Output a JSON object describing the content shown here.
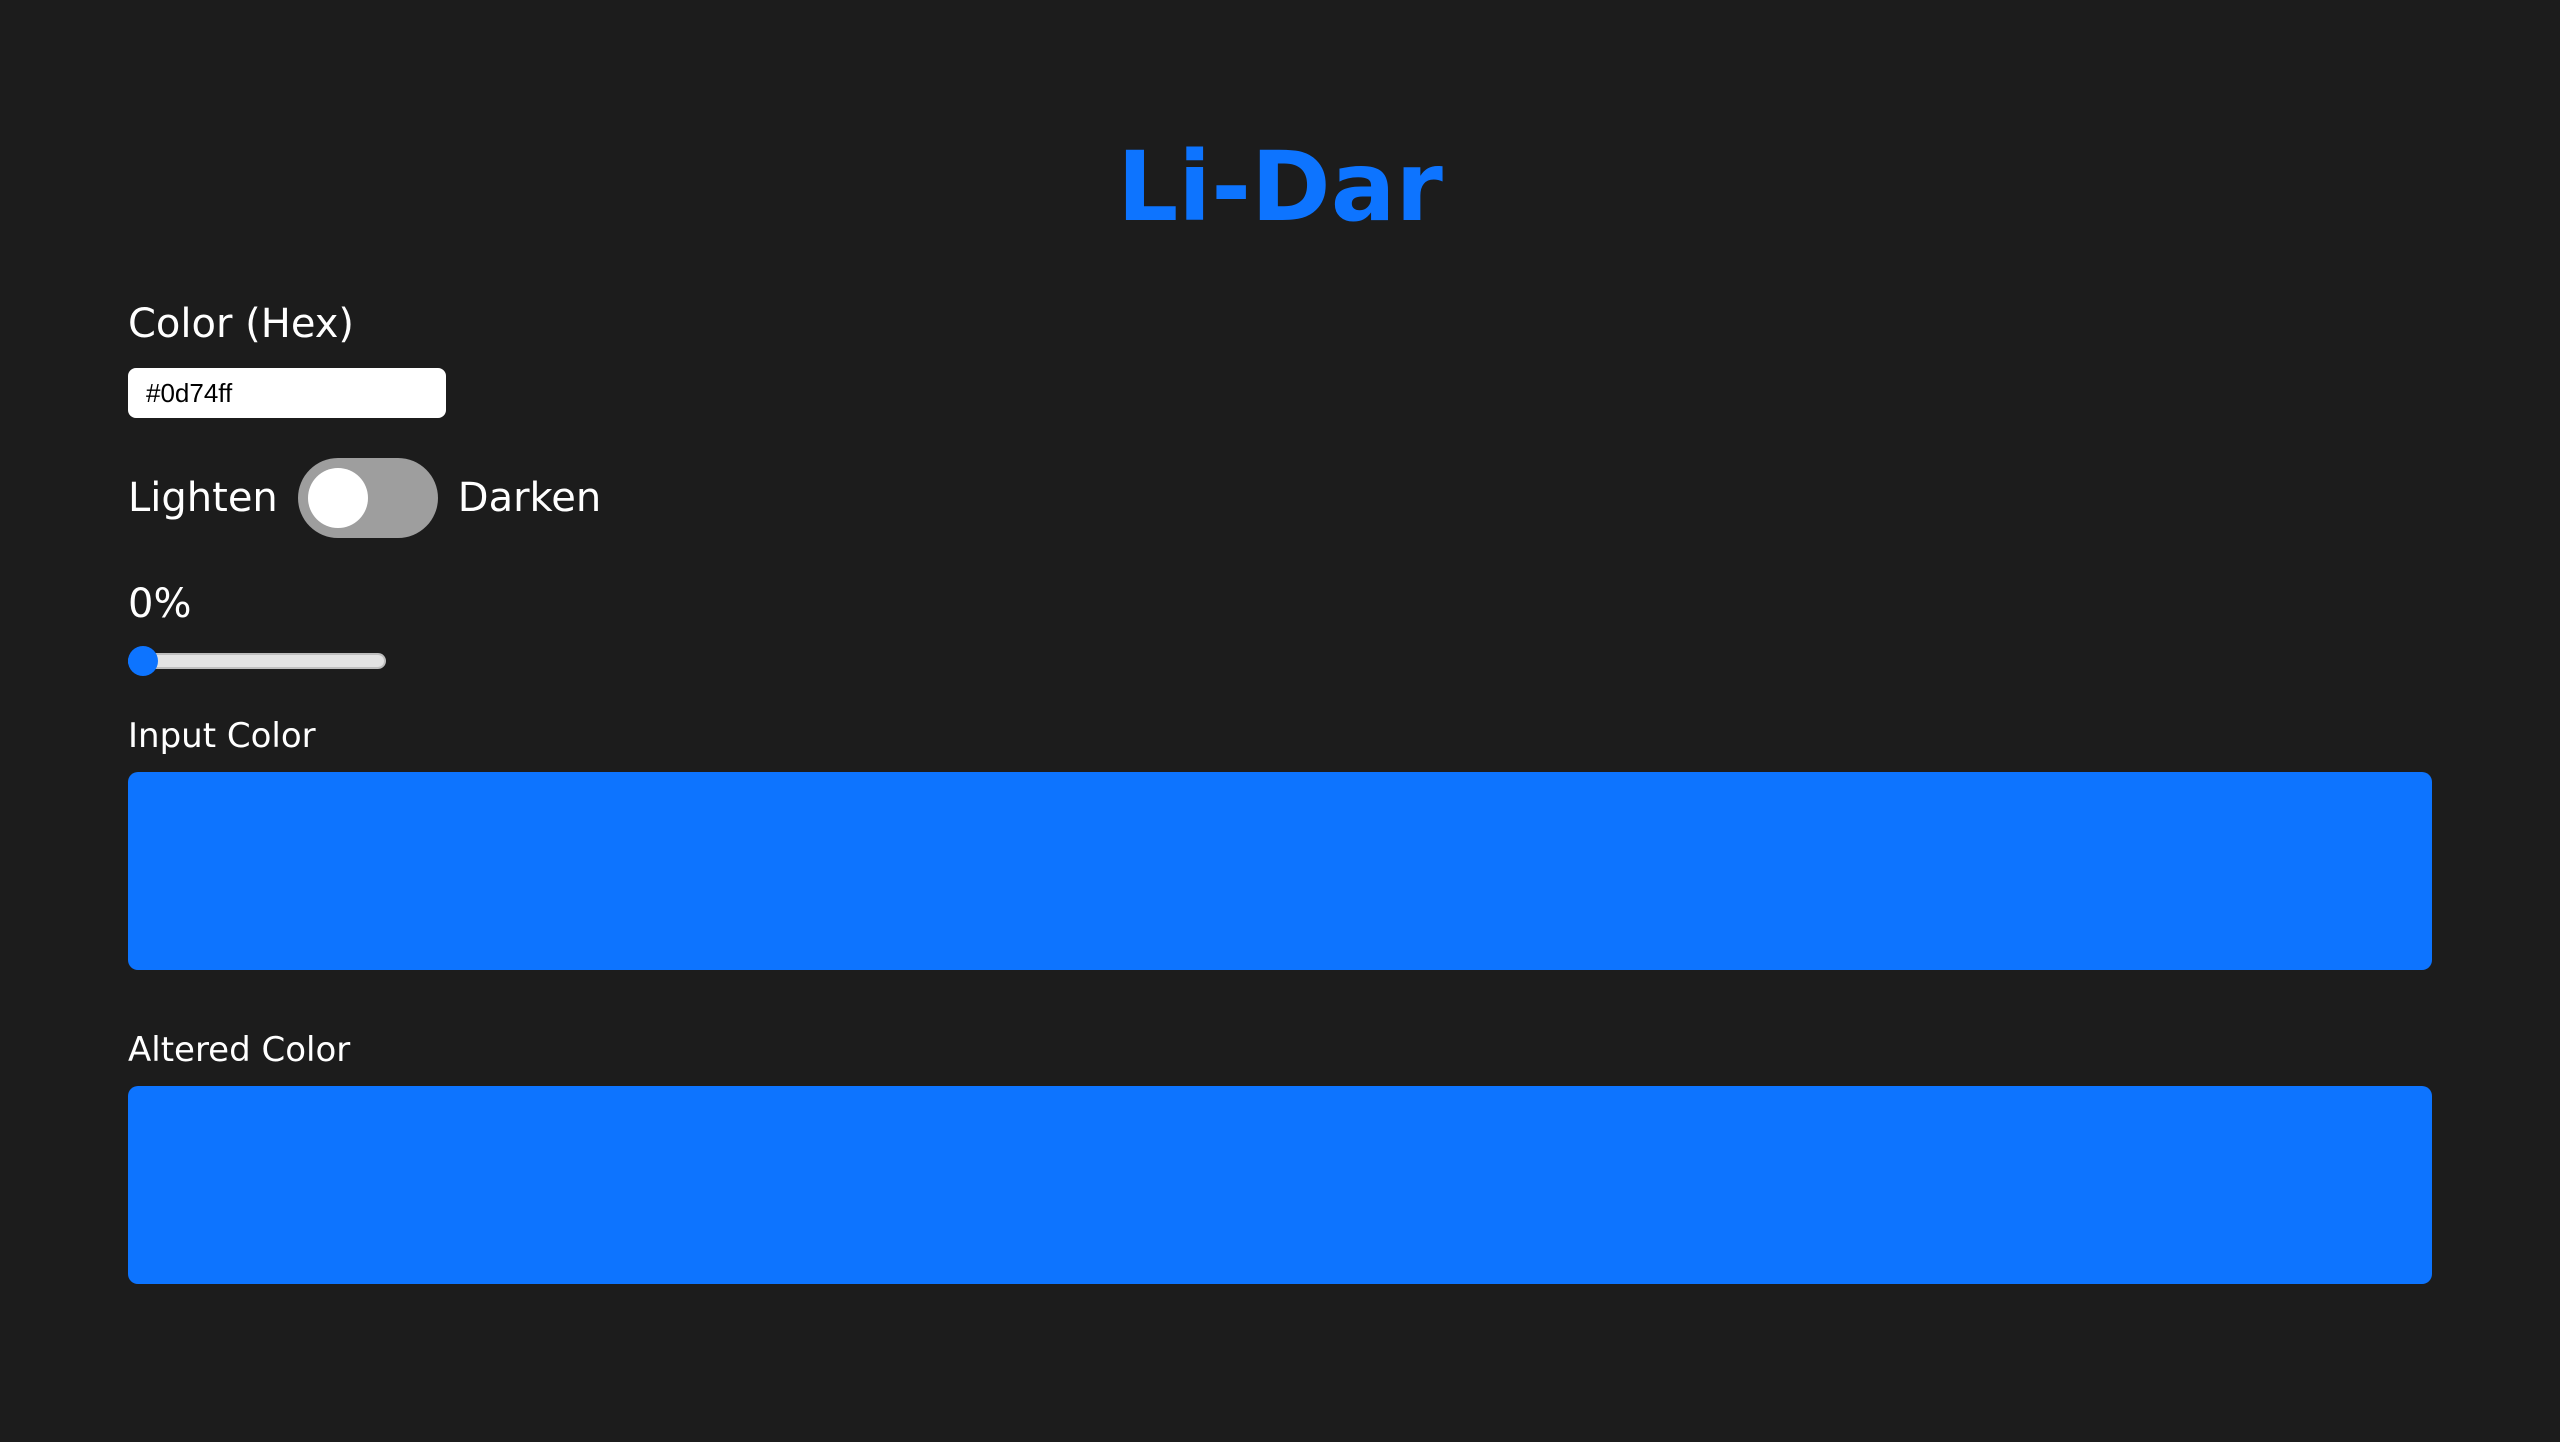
{
  "app": {
    "title": "Li-Dar"
  },
  "hex_field": {
    "label": "Color (Hex)",
    "value": "#0d74ff"
  },
  "mode_toggle": {
    "left_label": "Lighten",
    "right_label": "Darken",
    "selected": "Lighten"
  },
  "amount_slider": {
    "display": "0%",
    "value": 0,
    "min": 0,
    "max": 100
  },
  "input_swatch": {
    "label": "Input Color",
    "color": "#0d74ff"
  },
  "altered_swatch": {
    "label": "Altered Color",
    "color": "#0d74ff"
  },
  "colors": {
    "background": "#1c1c1c",
    "accent": "#0d74ff",
    "toggle_track": "#9e9e9e"
  }
}
